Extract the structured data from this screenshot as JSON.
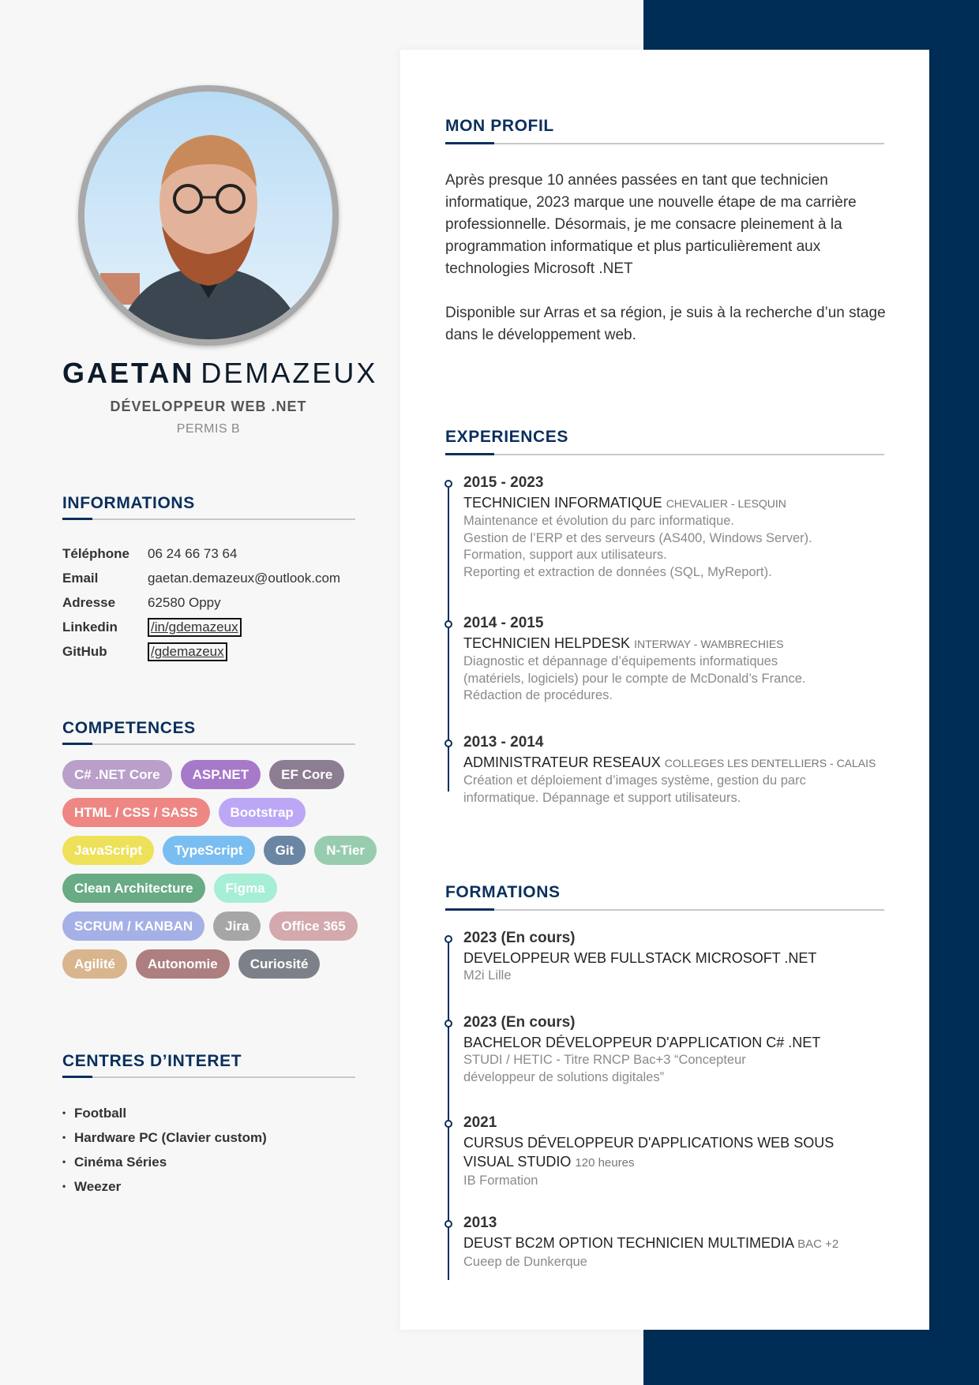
{
  "left": {
    "name_first": "GAETAN",
    "name_last": "DEMAZEUX",
    "job_title": "DÉVELOPPEUR WEB .NET",
    "license": "PERMIS B",
    "info_title": "INFORMATIONS",
    "info": [
      {
        "label": "Téléphone",
        "value": "06 24 66 73 64"
      },
      {
        "label": "Email",
        "value": "gaetan.demazeux@outlook.com"
      },
      {
        "label": "Adresse",
        "value": "62580 Oppy"
      },
      {
        "label": "Linkedin",
        "value": "/in/gdemazeux"
      },
      {
        "label": "GitHub",
        "value": "/gdemazeux"
      }
    ],
    "skills_title": "COMPETENCES",
    "skills": [
      {
        "label": "C# .NET Core",
        "color": "#b99fc9"
      },
      {
        "label": "ASP.NET",
        "color": "#a779c9"
      },
      {
        "label": "EF Core",
        "color": "#8c7d92"
      },
      {
        "label": "HTML / CSS / SASS",
        "color": "#ee8783"
      },
      {
        "label": "Bootstrap",
        "color": "#bba7f5"
      },
      {
        "label": "JavaScript",
        "color": "#ede159"
      },
      {
        "label": "TypeScript",
        "color": "#79bdf1"
      },
      {
        "label": "Git",
        "color": "#6a86a3"
      },
      {
        "label": "N-Tier",
        "color": "#98ccae"
      },
      {
        "label": "Clean Architecture",
        "color": "#69ab84"
      },
      {
        "label": "Figma",
        "color": "#a6eed6"
      },
      {
        "label": "SCRUM / KANBAN",
        "color": "#a5b0e6"
      },
      {
        "label": "Jira",
        "color": "#a6a6a6"
      },
      {
        "label": "Office 365",
        "color": "#d3a9ad"
      },
      {
        "label": "Agilité",
        "color": "#d9b58d"
      },
      {
        "label": "Autonomie",
        "color": "#ad7f80"
      },
      {
        "label": "Curiosité",
        "color": "#7c8189"
      }
    ],
    "interests_title": "CENTRES D’INTERET",
    "interests": [
      "Football",
      "Hardware PC (Clavier custom)",
      "Cinéma Séries",
      "Weezer"
    ]
  },
  "profile": {
    "title": "MON PROFIL",
    "paragraph_1": "Après presque 10 années passées en tant que technicien informatique, 2023 marque une nouvelle étape de ma carrière professionnelle. Désormais, je me consacre pleinement à la programmation informatique et plus particulièrement aux technologies Microsoft .NET",
    "paragraph_2": "Disponible sur Arras et sa région, je suis à la recherche d’un stage dans le développement web."
  },
  "experiences": {
    "title": "EXPERIENCES",
    "items": [
      {
        "date": "2015 - 2023",
        "role": "TECHNICIEN INFORMATIQUE",
        "company": "Chevalier - Lesquin",
        "lines": [
          "Maintenance et évolution du parc informatique.",
          "Gestion de l’ERP et des serveurs (AS400, Windows Server).",
          "Formation, support aux utilisateurs.",
          "Reporting et extraction de données (SQL, MyReport)."
        ]
      },
      {
        "date": "2014 - 2015",
        "role": "TECHNICIEN HELPDESK",
        "company": "Interway - Wambrechies",
        "lines": [
          "Diagnostic et dépannage d’équipements informatiques",
          "(matériels, logiciels) pour le compte de McDonald’s France.",
          "Rédaction de procédures."
        ]
      },
      {
        "date": "2013 - 2014",
        "role": "ADMINISTRATEUR RESEAUX",
        "company": "Colleges les Dentelliers - Calais",
        "lines": [
          "Création et déploiement d’images système, gestion du parc",
          "informatique. Dépannage et support utilisateurs."
        ]
      }
    ]
  },
  "formations": {
    "title": "FORMATIONS",
    "items": [
      {
        "date": "2023 (En cours)",
        "role": "DEVELOPPEUR WEB FULLSTACK MICROSOFT .NET",
        "lines": [
          "M2i Lille"
        ]
      },
      {
        "date": "2023 (En cours)",
        "role": "BACHELOR DÉVELOPPEUR D'APPLICATION C# .NET",
        "lines": [
          "STUDI / HETIC - Titre RNCP Bac+3 “Concepteur",
          "développeur de solutions digitales”"
        ]
      },
      {
        "date": "2021",
        "role_line_1": "CURSUS DÉVELOPPEUR D'APPLICATIONS WEB SOUS",
        "role_line_2": "VISUAL STUDIO",
        "hours": "120 heures",
        "lines": [
          "IB Formation"
        ]
      },
      {
        "date": "2013",
        "role": "DEUST BC2M OPTION TECHNICIEN MULTIMEDIA",
        "level": "BAC +2",
        "lines": [
          "Cueep de Dunkerque"
        ]
      }
    ]
  }
}
